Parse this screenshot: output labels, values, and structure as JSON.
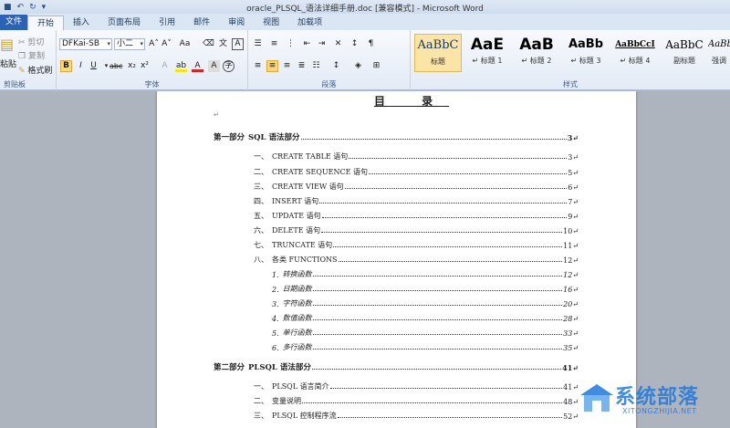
{
  "window": {
    "title": "oracle_PLSQL_语法详细手册.doc [兼容模式] - Microsoft Word"
  },
  "tabs": [
    {
      "label": "文件"
    },
    {
      "label": "开始"
    },
    {
      "label": "插入"
    },
    {
      "label": "页面布局"
    },
    {
      "label": "引用"
    },
    {
      "label": "邮件"
    },
    {
      "label": "审阅"
    },
    {
      "label": "视图"
    },
    {
      "label": "加载项"
    }
  ],
  "ribbon": {
    "clipboard": {
      "paste": "粘贴",
      "cut": "剪切",
      "copy": "复制",
      "format_painter": "格式刷",
      "group_label": "剪贴板"
    },
    "font": {
      "font_name": "DFKai-SB",
      "font_size": "小二",
      "group_label": "字体"
    },
    "paragraph": {
      "group_label": "段落"
    },
    "styles": {
      "group_label": "样式",
      "items": [
        {
          "sample": "AaBbC",
          "name": "标题"
        },
        {
          "sample": "AaE",
          "name": "↵ 标题 1"
        },
        {
          "sample": "AaB",
          "name": "↵ 标题 2"
        },
        {
          "sample": "AaBb",
          "name": "↵ 标题 3"
        },
        {
          "sample": "AaBbCcI",
          "name": "↵ 标题 4"
        },
        {
          "sample": "AaBbC",
          "name": "副标题"
        },
        {
          "sample": "AaBbCcI",
          "name": "强调"
        }
      ]
    }
  },
  "document": {
    "title": "目 录",
    "toc": [
      {
        "num": "第一部分",
        "text": "SQL 语法部分",
        "page": "3↵"
      },
      {
        "num": "一、",
        "text": "CREATE TABLE 语句",
        "page": "3↵"
      },
      {
        "num": "二、",
        "text": "CREATE SEQUENCE 语句",
        "page": "5↵"
      },
      {
        "num": "三、",
        "text": "CREATE VIEW 语句",
        "page": "6↵"
      },
      {
        "num": "四、",
        "text": "INSERT 语句",
        "page": "7↵"
      },
      {
        "num": "五、",
        "text": "UPDATE 语句",
        "page": "9↵"
      },
      {
        "num": "六、",
        "text": "DELETE 语句",
        "page": "10↵"
      },
      {
        "num": "七、",
        "text": "TRUNCATE 语句",
        "page": "11↵"
      },
      {
        "num": "八、",
        "text": "各类 FUNCTIONS",
        "page": "12↵"
      },
      {
        "num": "1.",
        "text": "转换函数",
        "page": "12↵"
      },
      {
        "num": "2.",
        "text": "日期函数",
        "page": "16↵"
      },
      {
        "num": "3.",
        "text": "字符函数",
        "page": "20↵"
      },
      {
        "num": "4.",
        "text": "数值函数",
        "page": "28↵"
      },
      {
        "num": "5.",
        "text": "单行函数",
        "page": "33↵"
      },
      {
        "num": "6.",
        "text": "多行函数",
        "page": "35↵"
      },
      {
        "num": "第二部分",
        "text": "PLSQL 语法部分",
        "page": "41↵"
      },
      {
        "num": "一、",
        "text": "PLSQL 语言简介",
        "page": "41↵"
      },
      {
        "num": "二、",
        "text": "变量说明",
        "page": "48↵"
      },
      {
        "num": "三、",
        "text": "PLSQL 控制程序流",
        "page": "52↵"
      }
    ]
  },
  "watermark": {
    "brand": "系统部落",
    "url": "XITONGZHIJIA.NET"
  }
}
